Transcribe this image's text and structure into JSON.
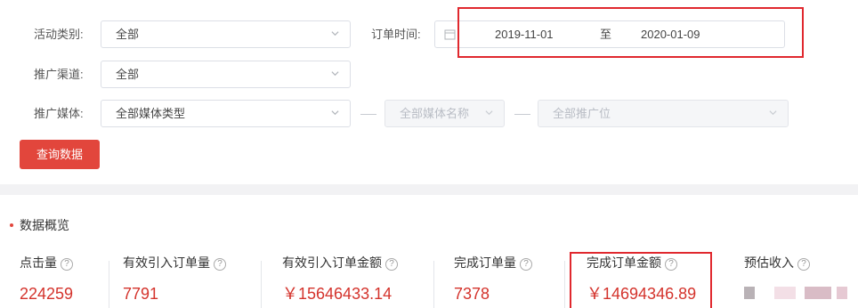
{
  "filters": {
    "activity_type": {
      "label": "活动类别:",
      "value": "全部"
    },
    "order_time": {
      "label": "订单时间:",
      "start": "2019-11-01",
      "separator": "至",
      "end": "2020-01-09"
    },
    "channel": {
      "label": "推广渠道:",
      "value": "全部"
    },
    "media": {
      "label": "推广媒体:",
      "type_value": "全部媒体类型",
      "name_value": "全部媒体名称",
      "position_value": "全部推广位"
    },
    "query_button": "查询数据"
  },
  "overview": {
    "title": "数据概览",
    "metrics": [
      {
        "label": "点击量",
        "value": "224259"
      },
      {
        "label": "有效引入订单量",
        "value": "7791"
      },
      {
        "label": "有效引入订单金额",
        "value": "￥15646433.14"
      },
      {
        "label": "完成订单量",
        "value": "7378"
      },
      {
        "label": "完成订单金额",
        "value": "￥14694346.89"
      },
      {
        "label": "预估收入",
        "value": ""
      }
    ],
    "help_glyph": "?"
  },
  "colors": {
    "accent": "#e2463c",
    "highlight": "#e0282e",
    "value": "#d4332c"
  }
}
